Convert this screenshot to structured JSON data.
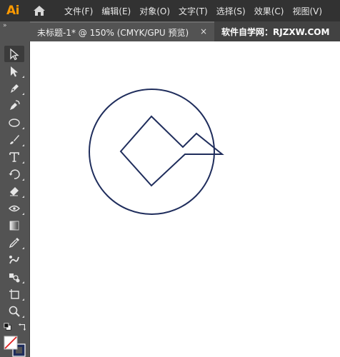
{
  "app": {
    "logo_text": "Ai"
  },
  "menu": [
    "文件(F)",
    "编辑(E)",
    "对象(O)",
    "文字(T)",
    "选择(S)",
    "效果(C)",
    "视图(V)"
  ],
  "tabs": {
    "collapse_glyph": "»",
    "document_title": "未标题-1* @ 150% (CMYK/GPU 预览)",
    "close_glyph": "×",
    "watermark": "软件自学网：RJZXW.COM"
  },
  "tools": [
    {
      "name": "selection-tool-icon",
      "selected": true
    },
    {
      "name": "direct-selection-tool-icon"
    },
    {
      "name": "pen-tool-icon"
    },
    {
      "name": "curvature-tool-icon"
    },
    {
      "name": "ellipse-tool-icon"
    },
    {
      "name": "paintbrush-tool-icon"
    },
    {
      "name": "type-tool-icon"
    },
    {
      "name": "rotate-tool-icon"
    },
    {
      "name": "eraser-tool-icon"
    },
    {
      "name": "width-tool-icon"
    },
    {
      "name": "gradient-tool-icon"
    },
    {
      "name": "eyedropper-tool-icon"
    },
    {
      "name": "blend-tool-icon"
    },
    {
      "name": "symbol-sprayer-tool-icon"
    },
    {
      "name": "artboard-tool-icon"
    },
    {
      "name": "zoom-tool-icon"
    }
  ],
  "colors": {
    "menubar_bg": "#323232",
    "toolbar_bg": "#535353",
    "tab_bg": "#535353",
    "logo": "#ff9a00",
    "artwork_stroke": "#1f2d5c",
    "canvas_bg": "#ffffff"
  }
}
